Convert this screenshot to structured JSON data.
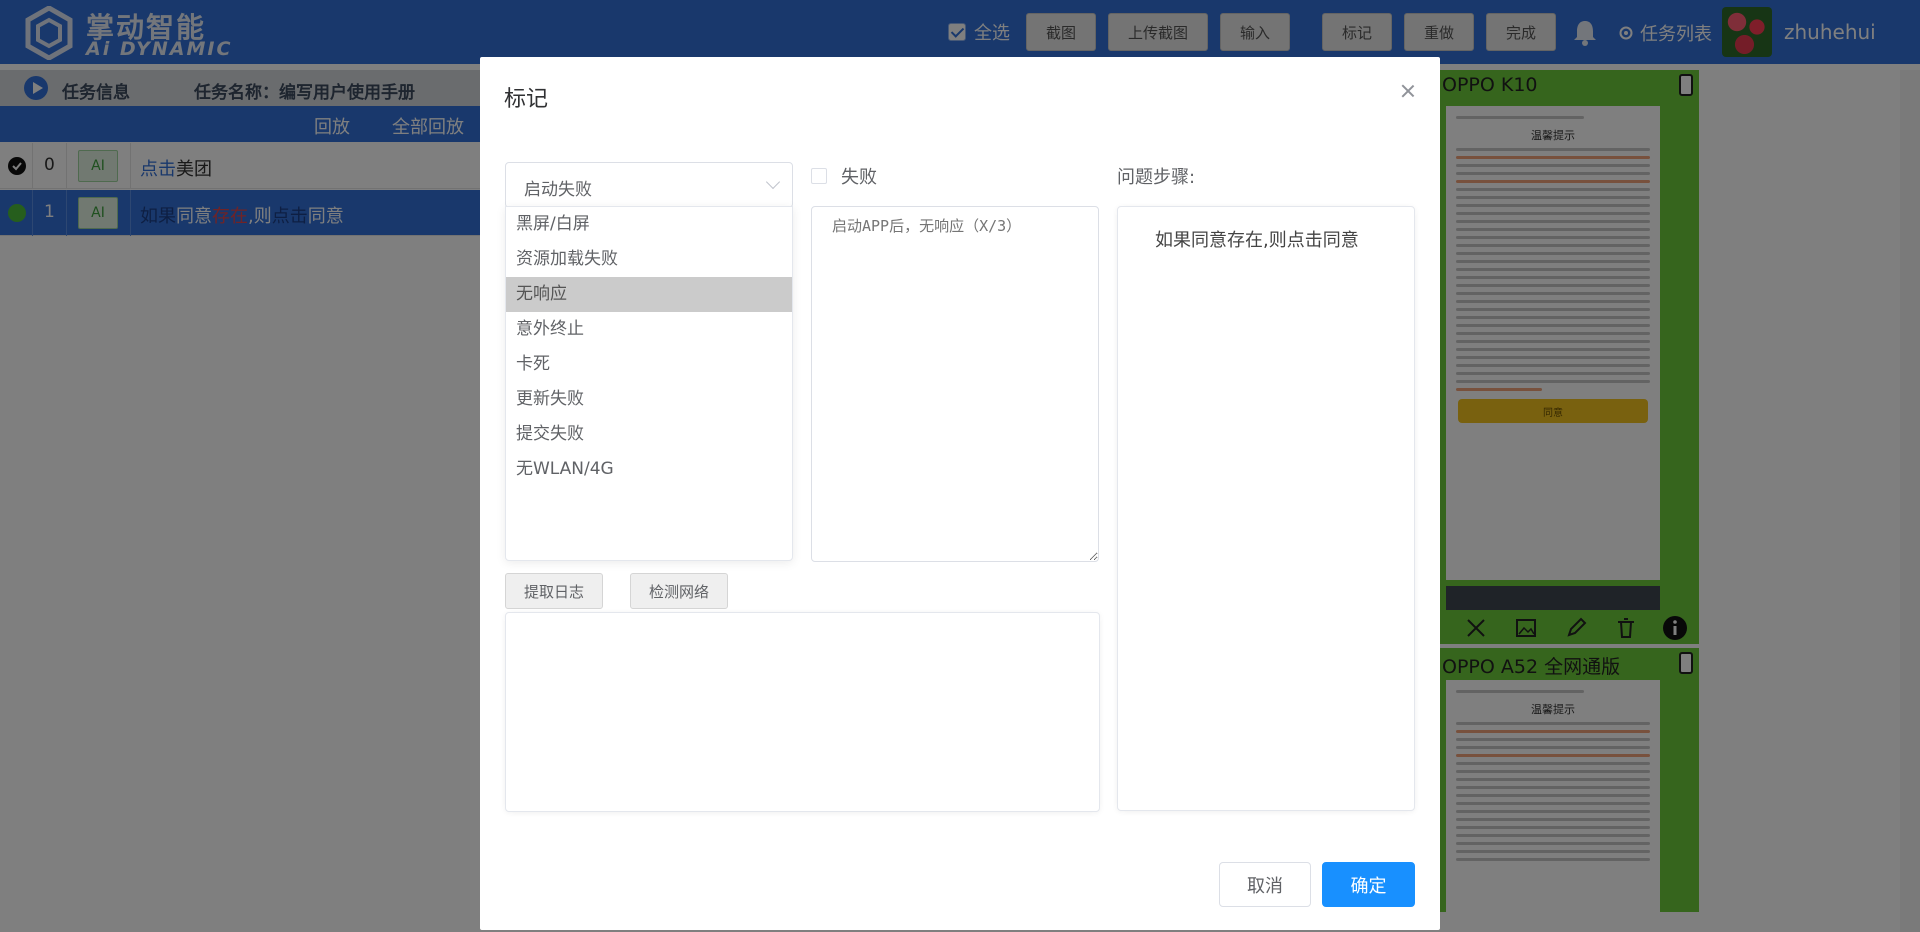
{
  "app": {
    "logo_cn": "掌动智能",
    "logo_en": "Ai DYNAMIC",
    "select_all_label": "全选",
    "toolbar": {
      "screenshot": "截图",
      "upload_screenshot": "上传截图",
      "input": "输入",
      "mark": "标记",
      "redo": "重做",
      "finish": "完成"
    },
    "task_list_label": "任务列表",
    "username": "zhuhehui",
    "brand_color": "#3271d9"
  },
  "task_info": {
    "label": "任务信息",
    "name": "任务名称：编写用户使用手册",
    "replay": "回放",
    "replay_all": "全部回放"
  },
  "steps": [
    {
      "index": "0",
      "ai": "AI",
      "action": "点击",
      "target": "美团"
    },
    {
      "index": "1",
      "ai": "AI",
      "p1": "如果",
      "p2": "同意",
      "p3": "存在",
      "p4": ",则",
      "p5": "点击",
      "p6": "同意"
    }
  ],
  "devices": [
    {
      "name": "OPPO K10",
      "screen_title": "温馨提示",
      "agree": "同意"
    },
    {
      "name": "OPPO A52 全网通版",
      "screen_title": "温馨提示"
    }
  ],
  "modal": {
    "title": "标记",
    "select_value": "启动失败",
    "options": [
      "黑屏/白屏",
      "资源加载失败",
      "无响应",
      "意外终止",
      "卡死",
      "更新失败",
      "提交失败",
      "无WLAN/4G"
    ],
    "highlighted_option": "无响应",
    "fail_label": "失败",
    "description_placeholder": "启动APP后，无响应（X/3）",
    "steps_label": "问题步骤:",
    "steps_text": "如果同意存在,则点击同意",
    "btn_extract_log": "提取日志",
    "btn_check_network": "检测网络",
    "btn_cancel": "取消",
    "btn_ok": "确定",
    "primary_color": "#1890ff"
  }
}
